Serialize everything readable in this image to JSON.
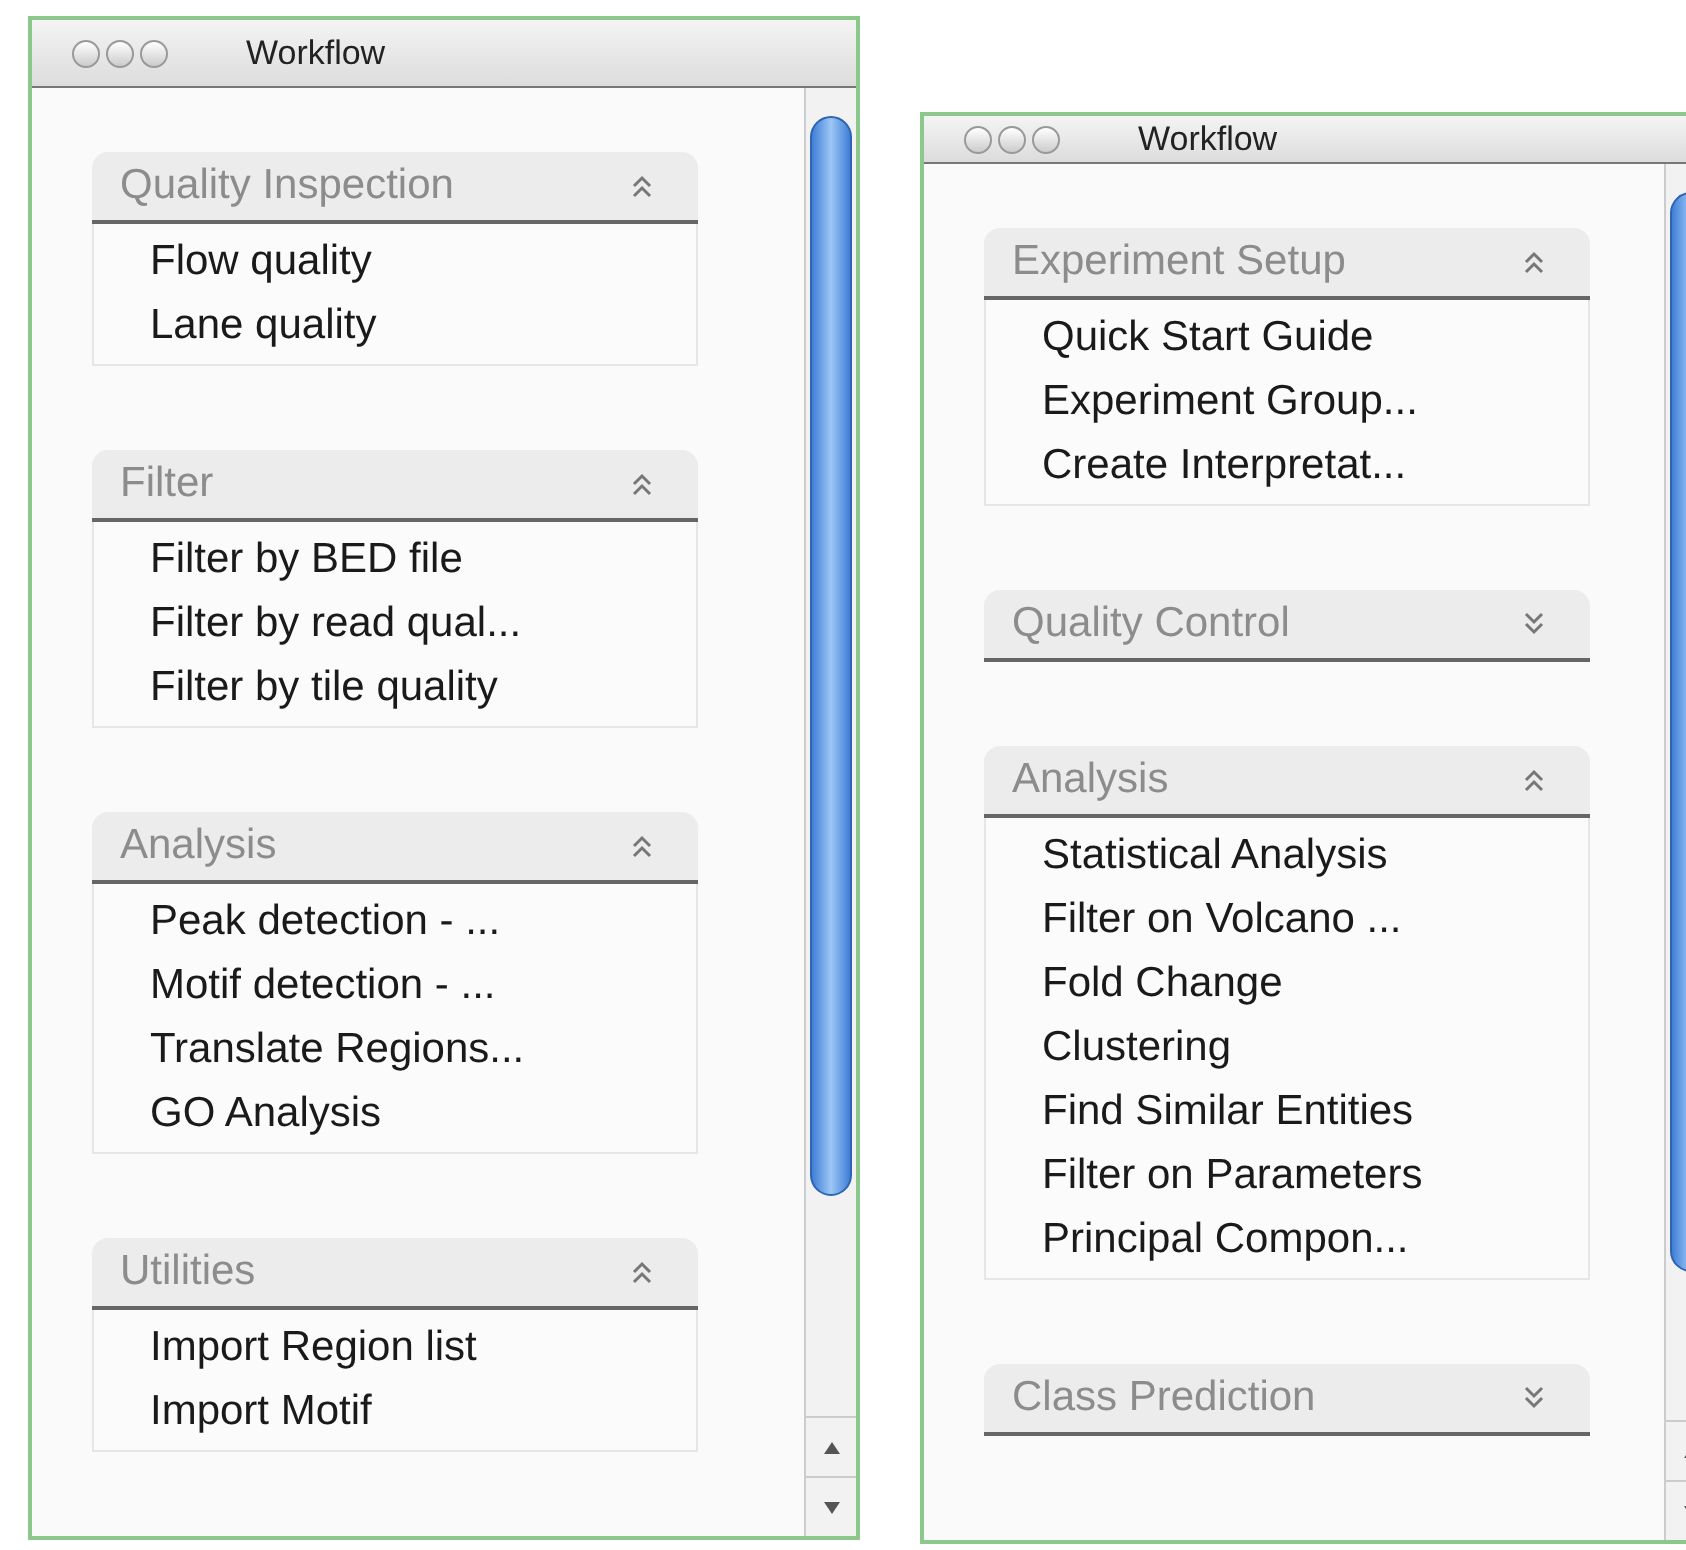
{
  "windows": [
    {
      "title": "Workflow",
      "groups": [
        {
          "title": "Quality Inspection",
          "expanded": true,
          "items": [
            "Flow quality",
            "Lane quality"
          ]
        },
        {
          "title": "Filter",
          "expanded": true,
          "items": [
            "Filter by BED file",
            "Filter by read qual...",
            "Filter by tile quality"
          ]
        },
        {
          "title": "Analysis",
          "expanded": true,
          "items": [
            "Peak detection - ...",
            "Motif detection - ...",
            "Translate Regions...",
            "GO Analysis"
          ]
        },
        {
          "title": "Utilities",
          "expanded": true,
          "items": [
            "Import Region list",
            "Import Motif"
          ]
        }
      ]
    },
    {
      "title": "Workflow",
      "groups": [
        {
          "title": "Experiment Setup",
          "expanded": true,
          "items": [
            "Quick Start Guide",
            "Experiment Group...",
            "Create Interpretat..."
          ]
        },
        {
          "title": "Quality Control",
          "expanded": false
        },
        {
          "title": "Analysis",
          "expanded": true,
          "items": [
            "Statistical Analysis",
            "Filter on Volcano ...",
            "Fold Change",
            "Clustering",
            "Find Similar Entities",
            "Filter on Parameters",
            "Principal Compon..."
          ]
        },
        {
          "title": "Class Prediction",
          "expanded": false
        }
      ]
    }
  ]
}
